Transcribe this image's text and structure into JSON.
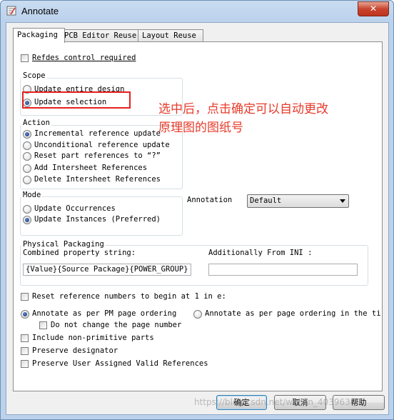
{
  "window": {
    "title": "Annotate",
    "close_label": "✕"
  },
  "tabs": [
    {
      "label": "Packaging",
      "active": true
    },
    {
      "label": "PCB Editor Reuse",
      "active": false
    },
    {
      "label": "Layout Reuse",
      "active": false
    }
  ],
  "refdes_control": {
    "label": "Refdes control required",
    "checked": false
  },
  "scope": {
    "label": "Scope",
    "options": [
      {
        "label": "Update entire design",
        "selected": false
      },
      {
        "label": "Update selection",
        "selected": true
      }
    ]
  },
  "action": {
    "label": "Action",
    "options": [
      {
        "label": "Incremental reference update",
        "selected": true
      },
      {
        "label": "Unconditional reference update",
        "selected": false
      },
      {
        "label": "Reset part references to “?”",
        "selected": false
      },
      {
        "label": "Add Intersheet References",
        "selected": false
      },
      {
        "label": "Delete Intersheet References",
        "selected": false
      }
    ]
  },
  "mode": {
    "label": "Mode",
    "options": [
      {
        "label": "Update Occurrences",
        "selected": false
      },
      {
        "label": "Update Instances (Preferred)",
        "selected": true
      }
    ]
  },
  "annotation_field": {
    "label": "Annotation",
    "value": "Default"
  },
  "physical_packaging": {
    "label": "Physical Packaging",
    "combined_label": "Combined property string:",
    "combined_value": "{Value}{Source Package}{POWER_GROUP}",
    "ini_label": "Additionally From INI :",
    "ini_value": ""
  },
  "reset_numbers": {
    "label": "Reset reference numbers to begin at 1 in e:",
    "checked": false
  },
  "ordering": {
    "pm_label": "Annotate as per PM page ordering",
    "pm_selected": true,
    "page_label": "Annotate as per page ordering in the ti",
    "page_selected": false
  },
  "do_not_change_page": {
    "label": "Do not change the page number",
    "checked": false
  },
  "include_non_primitive": {
    "label": "Include non-primitive parts",
    "checked": false
  },
  "preserve_designator": {
    "label": "Preserve designator",
    "checked": false
  },
  "preserve_user_refs": {
    "label": "Preserve User Assigned Valid References",
    "checked": false
  },
  "buttons": {
    "ok": "确定",
    "cancel": "取消",
    "help": "帮助"
  },
  "annotation_note": {
    "line1": "选中后，点击确定可以自动更改",
    "line2": "原理图的图纸号"
  },
  "watermark": "https://blog.csdn.net/weixin_40396300",
  "colors": {
    "highlight": "#e5201f",
    "note": "#e83a2a",
    "title_bar": "#bcd2ec"
  }
}
